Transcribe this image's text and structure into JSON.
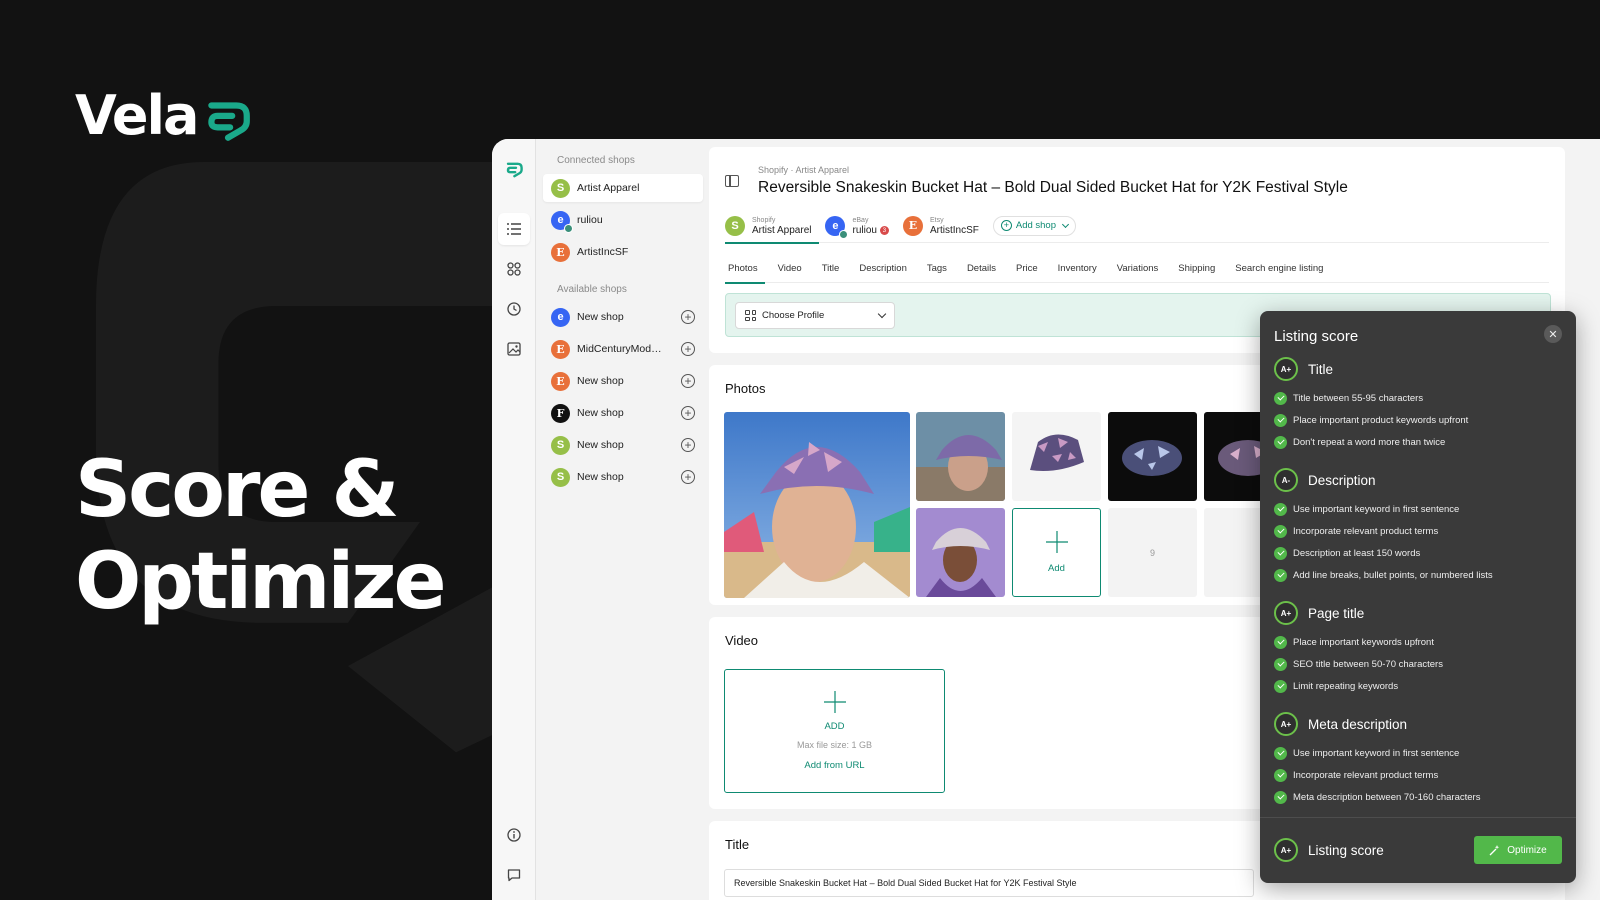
{
  "brand": {
    "name": "Vela"
  },
  "hero": {
    "line1": "Score &",
    "line2": "Optimize"
  },
  "colors": {
    "accent": "#0e8a72",
    "brand_teal": "#1aa98a",
    "score_green": "#52b84a",
    "panel_bg": "#3a3a3a"
  },
  "rail": {
    "icons": [
      "logo-icon",
      "list-icon",
      "apps-icon",
      "clock-icon",
      "image-icon",
      "info-icon",
      "chat-icon"
    ],
    "active": "list-icon"
  },
  "shops": {
    "connected_heading": "Connected shops",
    "connected": [
      {
        "name": "Artist Apparel",
        "platform": "shopify",
        "active": true
      },
      {
        "name": "ruliou",
        "platform": "ebay"
      },
      {
        "name": "ArtistIncSF",
        "platform": "etsy"
      }
    ],
    "available_heading": "Available shops",
    "available": [
      {
        "name": "New shop",
        "platform": "ebay"
      },
      {
        "name": "MidCenturyMode...",
        "platform": "etsy"
      },
      {
        "name": "New shop",
        "platform": "etsy"
      },
      {
        "name": "New shop",
        "platform": "f"
      },
      {
        "name": "New shop",
        "platform": "shopify"
      },
      {
        "name": "New shop",
        "platform": "shopify"
      }
    ]
  },
  "product": {
    "breadcrumb": "Shopify · Artist Apparel",
    "title": "Reversible Snakeskin Bucket Hat – Bold Dual Sided Bucket Hat for Y2K Festival Style"
  },
  "shop_tabs": [
    {
      "platform_label": "Shopify",
      "name": "Artist Apparel",
      "active": true
    },
    {
      "platform_label": "eBay",
      "name": "ruliou",
      "badge": "3"
    },
    {
      "platform_label": "Etsy",
      "name": "ArtistIncSF"
    }
  ],
  "add_shop_label": "Add shop",
  "tabs": [
    "Photos",
    "Video",
    "Title",
    "Description",
    "Tags",
    "Details",
    "Price",
    "Inventory",
    "Variations",
    "Shipping",
    "Search engine listing"
  ],
  "active_tab": "Photos",
  "profile": {
    "label": "Choose Profile"
  },
  "photos": {
    "heading": "Photos",
    "add_label": "Add",
    "slot_number": "9"
  },
  "video": {
    "heading": "Video",
    "add_label": "ADD",
    "max_size": "Max file size: 1 GB",
    "url_label": "Add from URL"
  },
  "title_section": {
    "heading": "Title",
    "value": "Reversible Snakeskin Bucket Hat – Bold Dual Sided Bucket Hat for Y2K Festival Style"
  },
  "listing_score": {
    "heading": "Listing score",
    "sections": [
      {
        "label": "Title",
        "grade": "A+",
        "criteria": [
          "Title between 55-95 characters",
          "Place important product keywords upfront",
          "Don't repeat a word more than twice"
        ]
      },
      {
        "label": "Description",
        "grade": "A-",
        "criteria": [
          "Use important keyword in first sentence",
          "Incorporate relevant product terms",
          "Description at least 150 words",
          "Add line breaks, bullet points, or numbered lists"
        ]
      },
      {
        "label": "Page title",
        "grade": "A+",
        "criteria": [
          "Place important keywords upfront",
          "SEO title between 50-70 characters",
          "Limit repeating keywords"
        ]
      },
      {
        "label": "Meta description",
        "grade": "A+",
        "criteria": [
          "Use important keyword in first sentence",
          "Incorporate relevant product terms",
          "Meta description between 70-160 characters"
        ]
      }
    ],
    "footer_label": "Listing score",
    "footer_grade": "A+",
    "optimize_label": "Optimize"
  }
}
